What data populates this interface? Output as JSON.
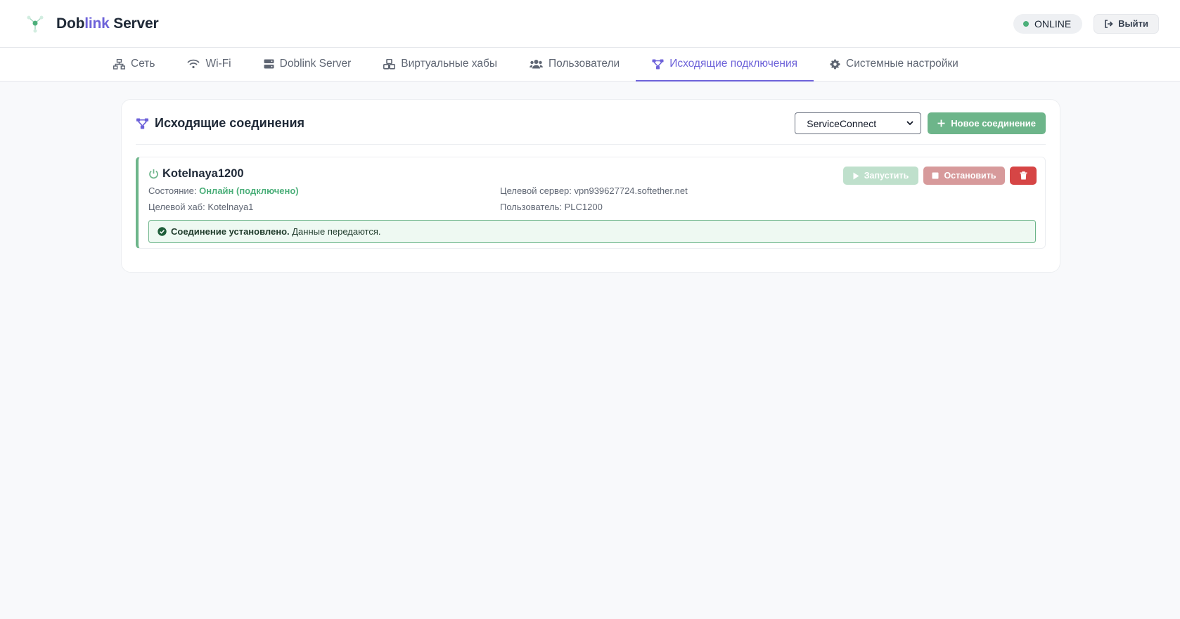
{
  "header": {
    "brand_part1": "Dob",
    "brand_part2": "link",
    "brand_part3": " Server",
    "status": "ONLINE",
    "logout_label": "Выйти"
  },
  "tabs": [
    {
      "label": "Сеть",
      "icon": "network-icon"
    },
    {
      "label": "Wi-Fi",
      "icon": "wifi-icon"
    },
    {
      "label": "Doblink Server",
      "icon": "server-icon"
    },
    {
      "label": "Виртуальные хабы",
      "icon": "cubes-icon"
    },
    {
      "label": "Пользователи",
      "icon": "users-icon"
    },
    {
      "label": "Исходящие подключения",
      "icon": "connection-icon",
      "active": true
    },
    {
      "label": "Системные настройки",
      "icon": "gear-icon"
    }
  ],
  "card": {
    "title": "Исходящие соединения",
    "select_value": "ServiceConnect",
    "new_button": "Новое соединение"
  },
  "connection": {
    "name": "Kotelnaya1200",
    "state_label": "Состояние: ",
    "state_value": "Онлайн (подключено)",
    "server_label": "Целевой сервер: ",
    "server_value": "vpn939627724.softether.net",
    "hub_label": "Целевой хаб: ",
    "hub_value": "Kotelnaya1",
    "user_label": "Пользователь: ",
    "user_value": "PLC1200",
    "start_label": "Запустить",
    "stop_label": "Остановить",
    "alert_bold": "Соединение установлено.",
    "alert_text": " Данные передаются."
  },
  "colors": {
    "accent": "#6d62d9",
    "success": "#6db58a",
    "danger": "#d64545"
  }
}
